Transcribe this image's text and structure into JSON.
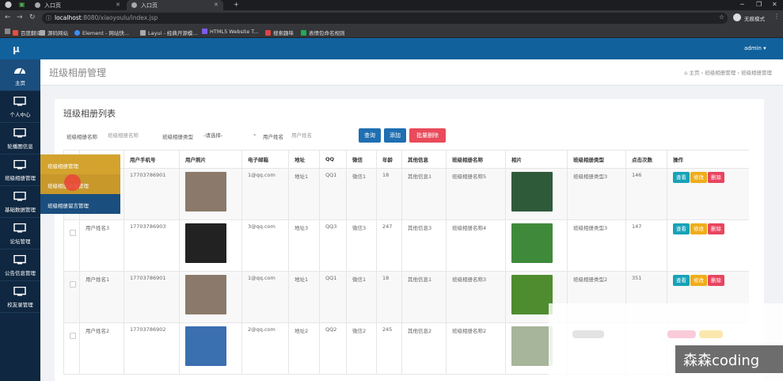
{
  "browser": {
    "tabs": [
      {
        "label": "入口页",
        "active": false
      },
      {
        "label": "入口页",
        "active": true
      }
    ],
    "new_tab": "+",
    "url_host": "localhost",
    "url_rest": ":8080/xiaoyoulu/index.jsp",
    "profile_label": "无痕模式",
    "bookmarks": [
      {
        "label": "百度翻译",
        "color": "#e84c3d"
      },
      {
        "label": "源码网站",
        "color": "#aaaaaa"
      },
      {
        "label": "Element - 网站快...",
        "color": "#3f8ef5"
      },
      {
        "label": "Layui - 经典开源模...",
        "color": "#aaaaaa"
      },
      {
        "label": "HTML5 Website T...",
        "color": "#7c5ce6"
      },
      {
        "label": "搜索趣味",
        "color": "#dd4444"
      },
      {
        "label": "表情包命名规则",
        "color": "#22aa55"
      }
    ]
  },
  "header": {
    "logo": "μ",
    "user": "admin ▾"
  },
  "sidebar": {
    "items": [
      {
        "label": "主页",
        "icon": "dashboard-icon"
      },
      {
        "label": "个人中心",
        "icon": "monitor-icon"
      },
      {
        "label": "轮播图信息",
        "icon": "monitor-icon"
      },
      {
        "label": "班级相册管理",
        "icon": "monitor-icon"
      },
      {
        "label": "基础数据管理",
        "icon": "monitor-icon"
      },
      {
        "label": "论坛管理",
        "icon": "monitor-icon"
      },
      {
        "label": "公告信息管理",
        "icon": "monitor-icon"
      },
      {
        "label": "校友录管理",
        "icon": "monitor-icon"
      }
    ],
    "submenu": [
      "班级相册管理",
      "班级相册收藏管理",
      "班级相册留言管理"
    ]
  },
  "titlebar": {
    "title": "班级相册管理",
    "breadcrumb": [
      "主页",
      "班级相册管理",
      "班级相册管理"
    ]
  },
  "card": {
    "title": "班级相册列表",
    "search": {
      "name_label": "班级相册名称",
      "name_placeholder": "班级相册名称",
      "type_label": "班级相册类型",
      "type_selected": "-请选择-",
      "user_label": "用户姓名",
      "user_placeholder": "用户姓名"
    },
    "buttons": {
      "search": "查询",
      "add": "添加",
      "batch_delete": "批量删除"
    }
  },
  "table": {
    "headers": [
      "",
      "",
      "用户手机号",
      "用户照片",
      "电子邮箱",
      "地址",
      "QQ",
      "微信",
      "年龄",
      "其他信息",
      "班级相册名称",
      "相片",
      "班级相册类型",
      "点击次数",
      "操作"
    ],
    "rows": [
      {
        "name": "",
        "phone": "17703786901",
        "email": "1@qq.com",
        "addr": "地址1",
        "qq": "QQ1",
        "wx": "微信1",
        "age": "18",
        "other": "其他信息1",
        "album": "班级相册名称5",
        "type": "班级相册类型3",
        "clicks": "146",
        "photo_color": "#8b7a6b",
        "pic_color": "#2e5a3a"
      },
      {
        "name": "用户姓名3",
        "phone": "17703786903",
        "email": "3@qq.com",
        "addr": "地址3",
        "qq": "QQ3",
        "wx": "微信3",
        "age": "247",
        "other": "其他信息3",
        "album": "班级相册名称4",
        "type": "班级相册类型3",
        "clicks": "147",
        "photo_color": "#222222",
        "pic_color": "#3f8a3a"
      },
      {
        "name": "用户姓名1",
        "phone": "17703786901",
        "email": "1@qq.com",
        "addr": "地址1",
        "qq": "QQ1",
        "wx": "微信1",
        "age": "18",
        "other": "其他信息1",
        "album": "班级相册名称3",
        "type": "班级相册类型2",
        "clicks": "351",
        "photo_color": "#8b7a6b",
        "pic_color": "#4f8c2f"
      },
      {
        "name": "用户姓名2",
        "phone": "17703786902",
        "email": "2@qq.com",
        "addr": "地址2",
        "qq": "QQ2",
        "wx": "微信2",
        "age": "245",
        "other": "其他信息2",
        "album": "班级相册名称2",
        "type": "",
        "clicks": "",
        "photo_color": "#3a6fb0",
        "pic_color": "#a7b59a"
      }
    ],
    "actions": {
      "view": "查看",
      "edit": "修改",
      "delete": "删除"
    }
  },
  "watermark": "森森coding"
}
